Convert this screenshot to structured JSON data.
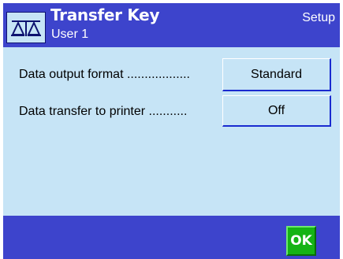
{
  "header": {
    "title": "Transfer Key",
    "subtitle": "User 1",
    "mode": "Setup",
    "icon": "balance-scale-icon"
  },
  "settings": [
    {
      "label": "Data output format ..................",
      "value": "Standard"
    },
    {
      "label": "Data transfer to printer ...........",
      "value": "Off"
    }
  ],
  "footer": {
    "ok_label": "OK"
  },
  "colors": {
    "header_bg": "#3d44cc",
    "panel_bg": "#c6e4f6",
    "ok_green": "#15b315"
  }
}
